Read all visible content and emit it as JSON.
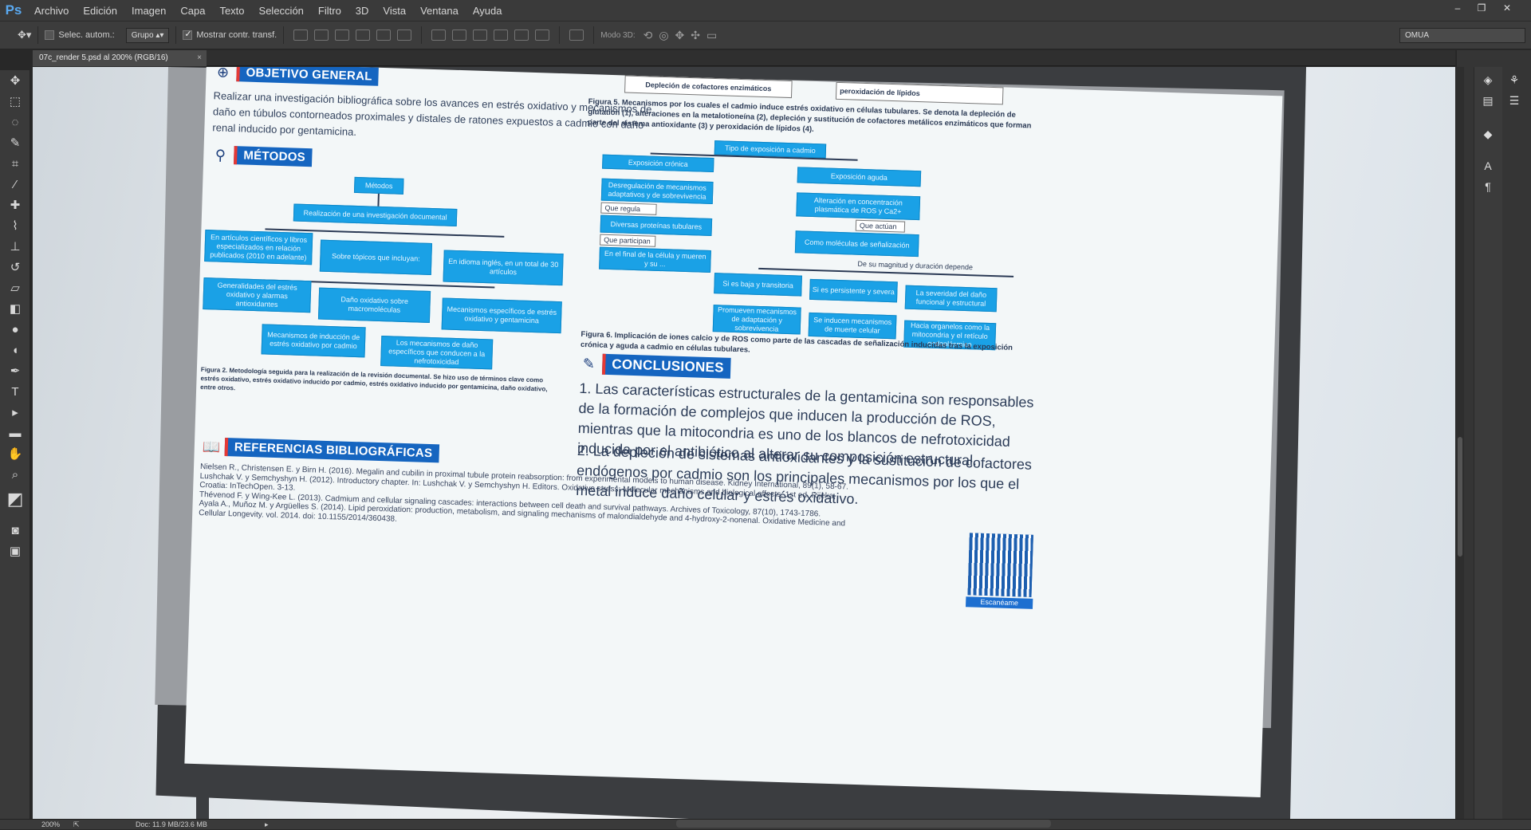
{
  "app": {
    "logo": "Ps"
  },
  "menu": [
    "Archivo",
    "Edición",
    "Imagen",
    "Capa",
    "Texto",
    "Selección",
    "Filtro",
    "3D",
    "Vista",
    "Ventana",
    "Ayuda"
  ],
  "options": {
    "auto_select": "Selec. autom.:",
    "group": "Grupo",
    "show_transform": "Mostrar contr. transf.",
    "mode3d": "Modo 3D:",
    "workspace": "OMUA"
  },
  "document": {
    "tab": "07c_render 5.psd al 200% (RGB/16)",
    "close": "×"
  },
  "status": {
    "zoom": "200%",
    "doc": "Doc: 11.9 MB/23.6 MB"
  },
  "poster": {
    "objetivo_title": "OBJETIVO GENERAL",
    "objetivo_text": "Realizar una investigación bibliográfica sobre los avances en estrés oxidativo y mecanismos de daño en túbulos contorneados proximales y distales de ratones expuestos a cadmio con daño renal inducido por gentamicina.",
    "metodos_title": "MÉTODOS",
    "m_boxes": {
      "b1": "Métodos",
      "b2": "Realización de una investigación documental",
      "b3": "En artículos científicos y libros especializados en relación publicados (2010 en adelante)",
      "b4": "Sobre tópicos que incluyan:",
      "b5": "En idioma inglés, en un total de 30 artículos",
      "b6": "Generalidades del estrés oxidativo y alarmas antioxidantes",
      "b7": "Daño oxidativo sobre macromoléculas",
      "b8": "Mecanismos específicos de estrés oxidativo y gentamicina",
      "b9": "Mecanismos de inducción de estrés oxidativo por cadmio",
      "b10": "Los mecanismos de daño específicos que conducen a la nefrotoxicidad"
    },
    "fig2_caption": "Figura 2. Metodología seguida para la realización de la revisión documental. Se hizo uso de términos clave como estrés oxidativo, estrés oxidativo inducido por cadmio, estrés oxidativo inducido por gentamicina, daño oxidativo, entre otros.",
    "top_box_left": "Depleción de cofactores enzimáticos",
    "top_box_right": "peroxidación de lípidos",
    "fig5_caption": "Figura 5. Mecanismos por los cuales el cadmio induce estrés oxidativo en células tubulares. Se denota la depleción de glutatión (1), alteraciones en la metalotioneína (2), depleción y sustitución de cofactores metálicos enzimáticos que forman parte del sistema antioxidante (3) y peroxidación de lípidos (4).",
    "r_boxes": {
      "t": "Tipo de exposición a cadmio",
      "cron": "Exposición crónica",
      "aguda": "Exposición aguda",
      "c1": "Desregulación de mecanismos adaptativos y de sobrevivencia",
      "w1": "Que regula",
      "c2": "Diversas proteínas tubulares",
      "w2": "Que participan",
      "c3": "En el final de la célula y mueren y su ...",
      "a1": "Alteración en concentración plasmática de ROS y Ca2+",
      "w3": "Que actúan",
      "a2": "Como moléculas de señalización",
      "w4": "De su magnitud y duración depende",
      "s1": "Si es baja y transitoria",
      "s2": "Si es persistente y severa",
      "s3": "La severidad del daño funcional y estructural",
      "s4": "Promueven mecanismos de adaptación y sobrevivencia",
      "s5": "Se inducen mecanismos de muerte celular",
      "s6": "Hacia organelos como la mitocondria y el retículo endoplásmico"
    },
    "fig6_caption": "Figura 6. Implicación de iones calcio y de ROS como parte de las cascadas de señalización inducidas tras la exposición crónica y aguda a cadmio en células tubulares.",
    "conclusiones_title": "CONCLUSIONES",
    "concl_1": "1. Las características estructurales de la gentamicina son responsables de la formación de complejos que inducen la producción de ROS, mientras que la mitocondria es uno de los blancos de nefrotoxicidad inducida por el antibiótico al alterar su composición estructural.",
    "concl_2": "2. La depleción de sistemas antioxidantes y la sustitución de cofactores endógenos por cadmio son los principales mecanismos por los que el metal induce daño celular y estrés oxidativo.",
    "refs_title": "REFERENCIAS BIBLIOGRÁFICAS",
    "refs": [
      "Nielsen R., Christensen E. y Birn H. (2016). Megalin and cubilin in proximal tubule protein reabsorption: from experimental models to human disease. Kidney International, 89(1), 58-67.",
      "Lushchak V. y Semchyshyn H. (2012). Introductory chapter. In: Lushchak V. y Semchyshyn H. Editors. Oxidative stress: Molecular mechanisms and biological effects. 1st ed. Rijeka,",
      "Croatia: InTechOpen. 3-13.",
      "Thévenod F. y Wing-Kee L. (2013). Cadmium and cellular signaling cascades: interactions between cell death and survival pathways. Archives of Toxicology, 87(10), 1743-1786.",
      "Ayala A., Muñoz M. y Argüelles S. (2014). Lipid peroxidation: production, metabolism, and signaling mechanisms of malondialdehyde and 4-hydroxy-2-nonenal. Oxidative Medicine and",
      "Cellular Longevity. vol. 2014. doi: 10.1155/2014/360438."
    ],
    "qr_label": "Escanéame"
  }
}
